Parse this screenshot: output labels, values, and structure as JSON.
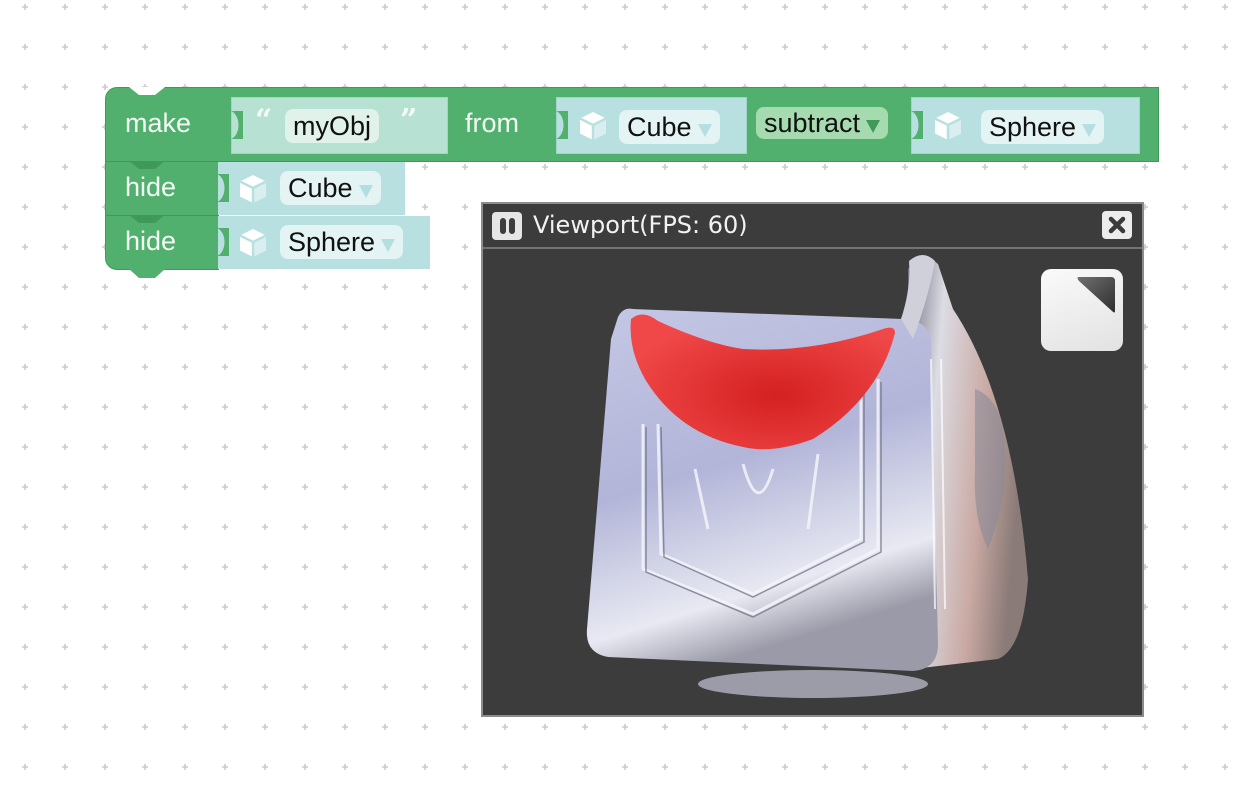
{
  "workspace": {
    "blocks": [
      {
        "type": "make",
        "keyword": "make",
        "name_input": {
          "value": "myObj"
        },
        "from_keyword": "from",
        "left_operand": {
          "icon": "cube-icon",
          "value": "Cube"
        },
        "operation": {
          "value": "subtract"
        },
        "right_operand": {
          "icon": "cube-icon",
          "value": "Sphere"
        }
      },
      {
        "type": "hide",
        "keyword": "hide",
        "operand": {
          "icon": "cube-icon",
          "value": "Cube"
        }
      },
      {
        "type": "hide",
        "keyword": "hide",
        "operand": {
          "icon": "cube-icon",
          "value": "Sphere"
        }
      }
    ]
  },
  "viewport": {
    "title": "Viewport(FPS: 60)",
    "pause_icon": "pause-icon",
    "close_icon": "close-icon",
    "fullscreen_icon": "fullscreen-icon",
    "scene_description": "Chrome cube with a red spherical cut on top"
  },
  "colors": {
    "block_green": "#52b06e",
    "object_input": "#b9e0e1",
    "string_input": "#b7e2d3",
    "viewport_bg": "#3c3c3c",
    "subtraction_red": "#e02626"
  }
}
